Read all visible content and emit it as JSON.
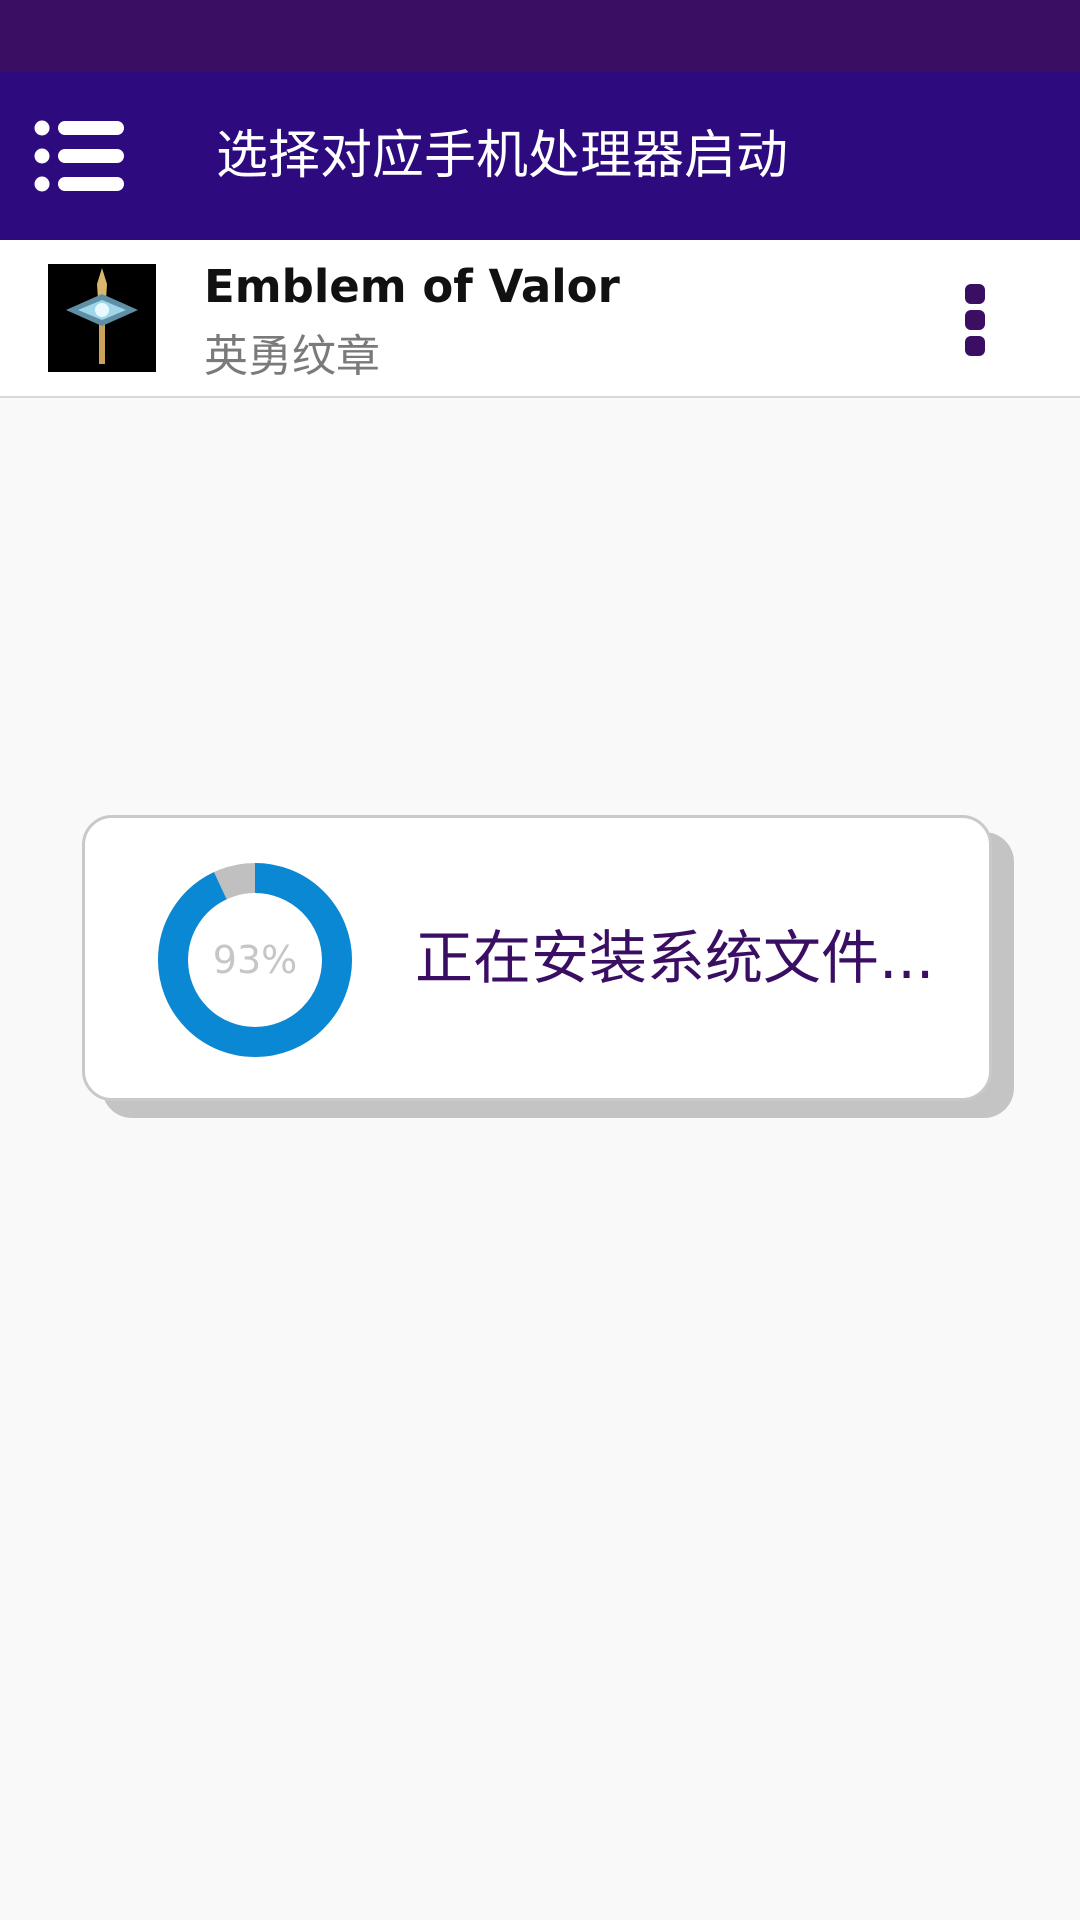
{
  "colors": {
    "status_bar": "#3a0e63",
    "app_bar": "#2d0b7e",
    "accent": "#3a0e63",
    "progress": "#0a88d4",
    "progress_track": "#c0c0c0",
    "background": "#f9f9f9"
  },
  "header": {
    "menu_icon": "menu-list-icon",
    "title": "选择对应手机处理器启动"
  },
  "game": {
    "thumbnail_icon": "sword-emblem-icon",
    "name": "Emblem of Valor",
    "subtitle": "英勇纹章",
    "more_icon": "more-vertical-icon"
  },
  "dialog": {
    "progress_fraction": 0.93,
    "progress_label": "93%",
    "message": "正在安装系统文件..."
  }
}
